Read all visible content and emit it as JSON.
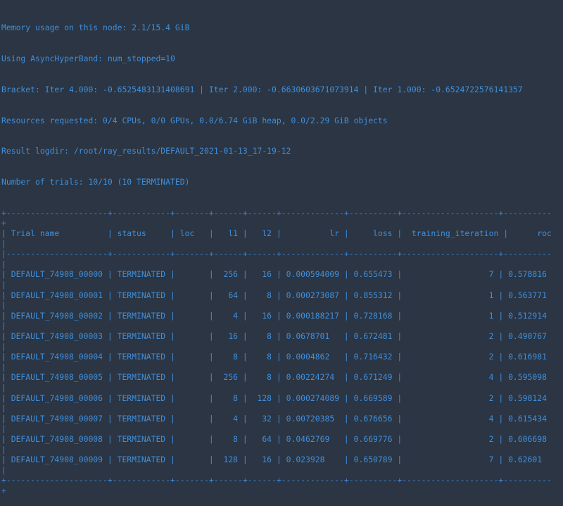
{
  "header_lines": [
    "Memory usage on this node: 2.1/15.4 GiB",
    "Using AsyncHyperBand: num_stopped=10",
    "Bracket: Iter 4.000: -0.6525483131408691 | Iter 2.000: -0.6630603671073914 | Iter 1.000: -0.6524722576141357",
    "Resources requested: 0/4 CPUs, 0/0 GPUs, 0.0/6.74 GiB heap, 0.0/2.29 GiB objects",
    "Result logdir: /root/ray_results/DEFAULT_2021-01-13_17-19-12",
    "Number of trials: 10/10 (10 TERMINATED)"
  ],
  "table": {
    "columns": [
      "Trial name",
      "status",
      "loc",
      "l1",
      "l2",
      "lr",
      "loss",
      "training_iteration",
      "roc"
    ],
    "rows": [
      [
        "DEFAULT_74908_00000",
        "TERMINATED",
        "",
        "256",
        "16",
        "0.000594009",
        "0.655473",
        "7",
        "0.578816"
      ],
      [
        "DEFAULT_74908_00001",
        "TERMINATED",
        "",
        "64",
        "8",
        "0.000273087",
        "0.855312",
        "1",
        "0.563771"
      ],
      [
        "DEFAULT_74908_00002",
        "TERMINATED",
        "",
        "4",
        "16",
        "0.000188217",
        "0.728168",
        "1",
        "0.512914"
      ],
      [
        "DEFAULT_74908_00003",
        "TERMINATED",
        "",
        "16",
        "8",
        "0.0678701",
        "0.672481",
        "2",
        "0.490767"
      ],
      [
        "DEFAULT_74908_00004",
        "TERMINATED",
        "",
        "8",
        "8",
        "0.0004862",
        "0.716432",
        "2",
        "0.616981"
      ],
      [
        "DEFAULT_74908_00005",
        "TERMINATED",
        "",
        "256",
        "8",
        "0.00224274",
        "0.671249",
        "4",
        "0.595098"
      ],
      [
        "DEFAULT_74908_00006",
        "TERMINATED",
        "",
        "8",
        "128",
        "0.000274089",
        "0.669589",
        "2",
        "0.598124"
      ],
      [
        "DEFAULT_74908_00007",
        "TERMINATED",
        "",
        "4",
        "32",
        "0.00720385",
        "0.676656",
        "4",
        "0.615434"
      ],
      [
        "DEFAULT_74908_00008",
        "TERMINATED",
        "",
        "8",
        "64",
        "0.0462769",
        "0.669776",
        "2",
        "0.606698"
      ],
      [
        "DEFAULT_74908_00009",
        "TERMINATED",
        "",
        "128",
        "16",
        "0.023928",
        "0.650789",
        "7",
        "0.62601"
      ]
    ]
  },
  "colors": {
    "background": "#2b3543",
    "text": "#3f8fdd"
  }
}
